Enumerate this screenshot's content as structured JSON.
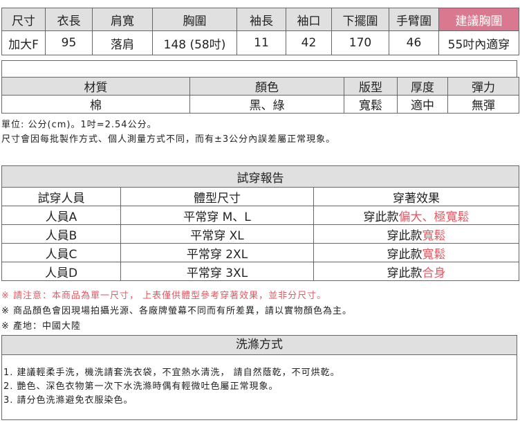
{
  "size_table": {
    "headers": [
      "尺寸",
      "衣長",
      "肩寬",
      "胸圍",
      "袖長",
      "袖口",
      "下擺圍",
      "手臂圍",
      "建議胸圍"
    ],
    "row": [
      "加大F",
      "95",
      "落肩",
      "148 (58吋)",
      "11",
      "42",
      "170",
      "46",
      "55吋內適穿"
    ]
  },
  "material_table": {
    "headers": [
      "材質",
      "顏色",
      "版型",
      "厚度",
      "彈力"
    ],
    "row": [
      "棉",
      "黑、綠",
      "寬鬆",
      "適中",
      "無彈"
    ]
  },
  "notes": {
    "unit": "單位: 公分(cm)。1吋=2.54公分。",
    "error": "尺寸會因每批製作方式、個人測量方式不同，而有±3公分內誤差屬正常現象。"
  },
  "trial_report": {
    "title": "試穿報告",
    "headers": [
      "試穿人員",
      "體型尺寸",
      "穿著效果"
    ],
    "rows": [
      {
        "person": "人員A",
        "size": "平常穿 M、L",
        "effect_prefix": "穿此款",
        "effect_highlight": "偏大、極寬鬆"
      },
      {
        "person": "人員B",
        "size": "平常穿 XL",
        "effect_prefix": "穿此款",
        "effect_highlight": "寬鬆"
      },
      {
        "person": "人員C",
        "size": "平常穿 2XL",
        "effect_prefix": "穿此款",
        "effect_highlight": "寬鬆"
      },
      {
        "person": "人員D",
        "size": "平常穿 3XL",
        "effect_prefix": "穿此款",
        "effect_highlight": "合身"
      }
    ]
  },
  "remarks": {
    "notice": "※ 請注意：本商品為單一尺寸， 上表僅供體型參考穿著效果，並非分尺寸。",
    "color": "※ 商品顏色會因現場拍攝光源、各廠牌螢幕不同而有所差異，請以實物顏色為主。",
    "origin": "※ 產地：中國大陸"
  },
  "washing": {
    "title": "洗滌方式",
    "items": [
      "1. 建議輕柔手洗，機洗請套洗衣袋，不宜熱水清洗， 請自然蔭乾，不可烘乾。",
      "2. 艷色、深色衣物第一次下水洗滌時偶有輕微吐色屬正常現象。",
      "3. 請分色洗滌避免衣服染色。"
    ]
  },
  "colors": {
    "header_bg": "#e0e0e0",
    "accent_pink": "#d9788e",
    "highlight_red": "#e05a63"
  }
}
